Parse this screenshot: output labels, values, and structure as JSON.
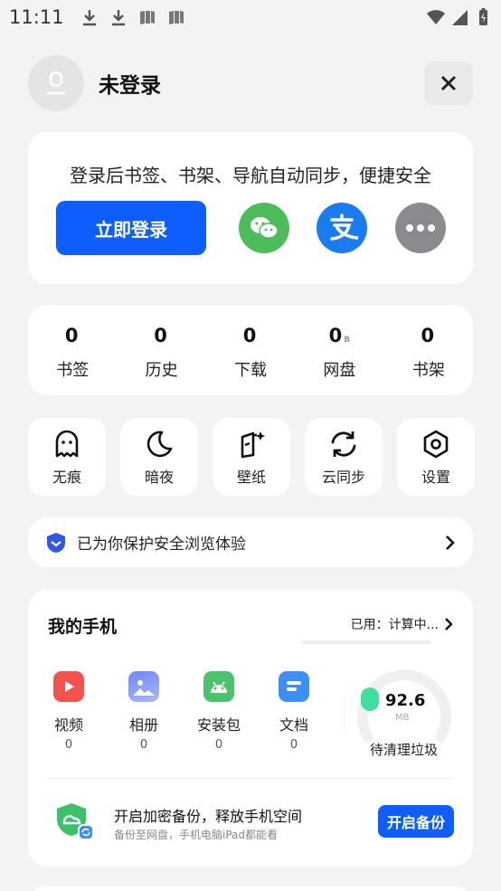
{
  "status": {
    "time": "11:11"
  },
  "header": {
    "title": "未登录"
  },
  "login": {
    "prompt": "登录后书签、书架、导航自动同步，便捷安全",
    "button": "立即登录"
  },
  "stats": [
    {
      "value": "0",
      "unit": "",
      "label": "书签"
    },
    {
      "value": "0",
      "unit": "",
      "label": "历史"
    },
    {
      "value": "0",
      "unit": "",
      "label": "下载"
    },
    {
      "value": "0",
      "unit": "B",
      "label": "网盘"
    },
    {
      "value": "0",
      "unit": "",
      "label": "书架"
    }
  ],
  "tools": [
    {
      "label": "无痕",
      "icon": "ghost-icon"
    },
    {
      "label": "暗夜",
      "icon": "moon-icon"
    },
    {
      "label": "壁纸",
      "icon": "wallpaper-icon"
    },
    {
      "label": "云同步",
      "icon": "sync-icon"
    },
    {
      "label": "设置",
      "icon": "settings-icon"
    }
  ],
  "security": {
    "text": "已为你保护安全浏览体验"
  },
  "phone": {
    "title": "我的手机",
    "usage": "已用：计算中...",
    "file_types": [
      {
        "label": "视频",
        "count": "0",
        "color": "#f4524d"
      },
      {
        "label": "相册",
        "count": "0",
        "color": "#6f86f6"
      },
      {
        "label": "安装包",
        "count": "0",
        "color": "#4cc36b"
      },
      {
        "label": "文档",
        "count": "0",
        "color": "#3d8ef7"
      }
    ],
    "junk": {
      "value": "92.6",
      "unit": "MB",
      "label": "待清理垃圾"
    },
    "backup": {
      "title": "开启加密备份，释放手机空间",
      "subtitle": "备份至网盘，手机电脑iPad都能看",
      "button": "开启备份"
    }
  },
  "colors": {
    "accent": "#0d5efc",
    "background": "#f2f3f5"
  }
}
